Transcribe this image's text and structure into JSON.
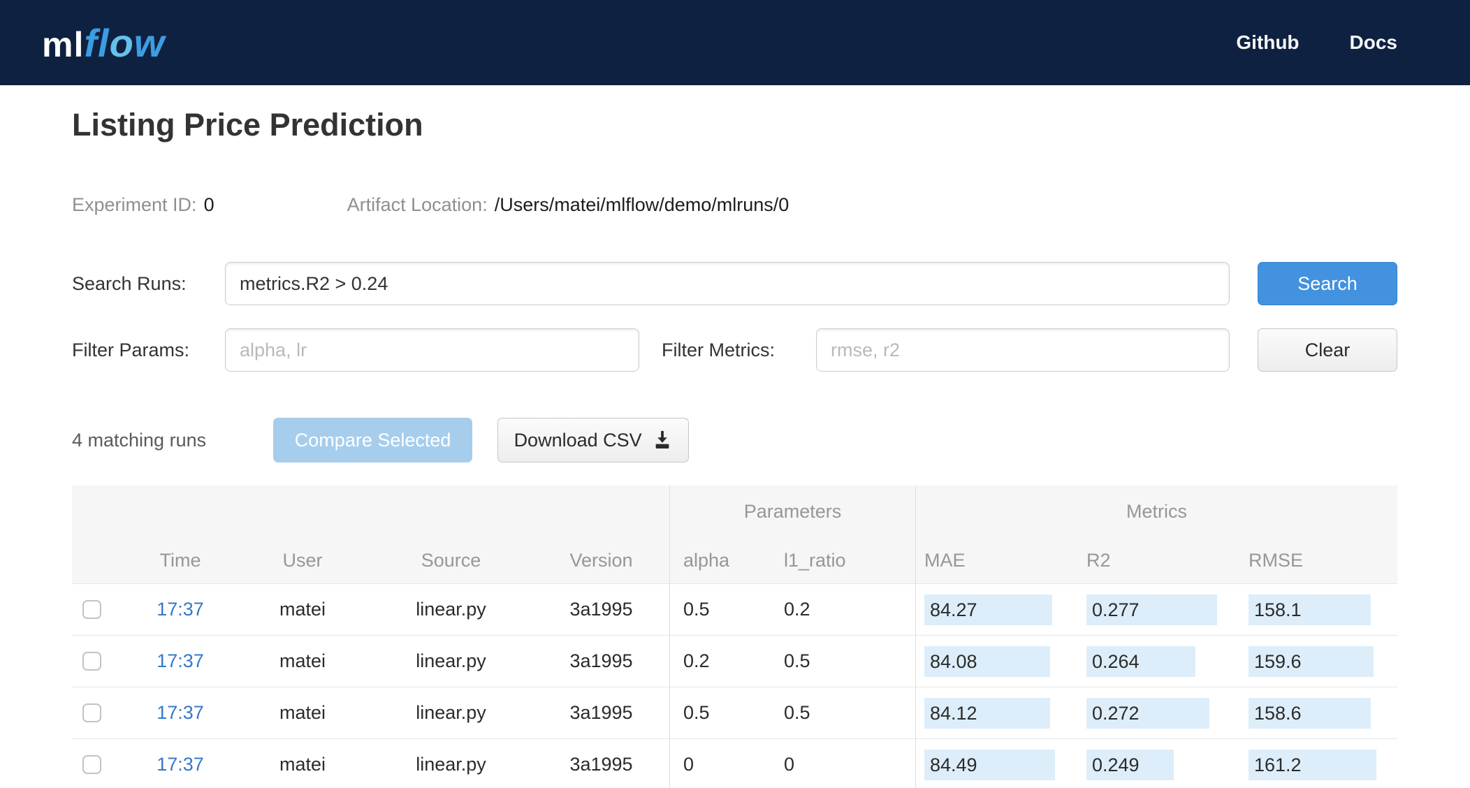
{
  "colors": {
    "navbar_bg": "#0f2140",
    "brand_blue": "#3d9de2",
    "brand_light_blue": "#63c1ea",
    "primary_button": "#4292df",
    "disabled_primary_button": "#a6cdec",
    "link_blue": "#3579c8",
    "metric_highlight": "#ddeefa"
  },
  "navbar": {
    "logo": {
      "ml": "ml",
      "flow_fl": "fl",
      "flow_o": "o",
      "flow_w": "w"
    },
    "links": {
      "github": "Github",
      "docs": "Docs"
    }
  },
  "page": {
    "title": "Listing Price Prediction",
    "experiment_id_label": "Experiment ID:",
    "experiment_id_value": "0",
    "artifact_location_label": "Artifact Location:",
    "artifact_location_value": "/Users/matei/mlflow/demo/mlruns/0"
  },
  "search": {
    "label": "Search Runs:",
    "value": "metrics.R2 > 0.24",
    "button_label": "Search"
  },
  "filters": {
    "params_label": "Filter Params:",
    "params_placeholder": "alpha, lr",
    "metrics_label": "Filter Metrics:",
    "metrics_placeholder": "rmse, r2",
    "clear_button_label": "Clear"
  },
  "actions": {
    "matching_runs": "4 matching runs",
    "compare_button_label": "Compare Selected",
    "download_button_label": "Download CSV"
  },
  "table": {
    "groups": {
      "parameters": "Parameters",
      "metrics": "Metrics"
    },
    "columns": {
      "time": "Time",
      "user": "User",
      "source": "Source",
      "version": "Version",
      "alpha": "alpha",
      "l1_ratio": "l1_ratio",
      "mae": "MAE",
      "r2": "R2",
      "rmse": "RMSE"
    },
    "rows": [
      {
        "time": "17:37",
        "user": "matei",
        "source": "linear.py",
        "version": "3a1995",
        "alpha": "0.5",
        "l1_ratio": "0.2",
        "mae": {
          "value": "84.27",
          "bar_pct": 83
        },
        "r2": {
          "value": "0.277",
          "bar_pct": 85
        },
        "rmse": {
          "value": "158.1",
          "bar_pct": 82
        }
      },
      {
        "time": "17:37",
        "user": "matei",
        "source": "linear.py",
        "version": "3a1995",
        "alpha": "0.2",
        "l1_ratio": "0.5",
        "mae": {
          "value": "84.08",
          "bar_pct": 82
        },
        "r2": {
          "value": "0.264",
          "bar_pct": 71
        },
        "rmse": {
          "value": "159.6",
          "bar_pct": 84
        }
      },
      {
        "time": "17:37",
        "user": "matei",
        "source": "linear.py",
        "version": "3a1995",
        "alpha": "0.5",
        "l1_ratio": "0.5",
        "mae": {
          "value": "84.12",
          "bar_pct": 82
        },
        "r2": {
          "value": "0.272",
          "bar_pct": 80
        },
        "rmse": {
          "value": "158.6",
          "bar_pct": 82
        }
      },
      {
        "time": "17:37",
        "user": "matei",
        "source": "linear.py",
        "version": "3a1995",
        "alpha": "0",
        "l1_ratio": "0",
        "mae": {
          "value": "84.49",
          "bar_pct": 85
        },
        "r2": {
          "value": "0.249",
          "bar_pct": 57
        },
        "rmse": {
          "value": "161.2",
          "bar_pct": 86
        }
      }
    ]
  }
}
